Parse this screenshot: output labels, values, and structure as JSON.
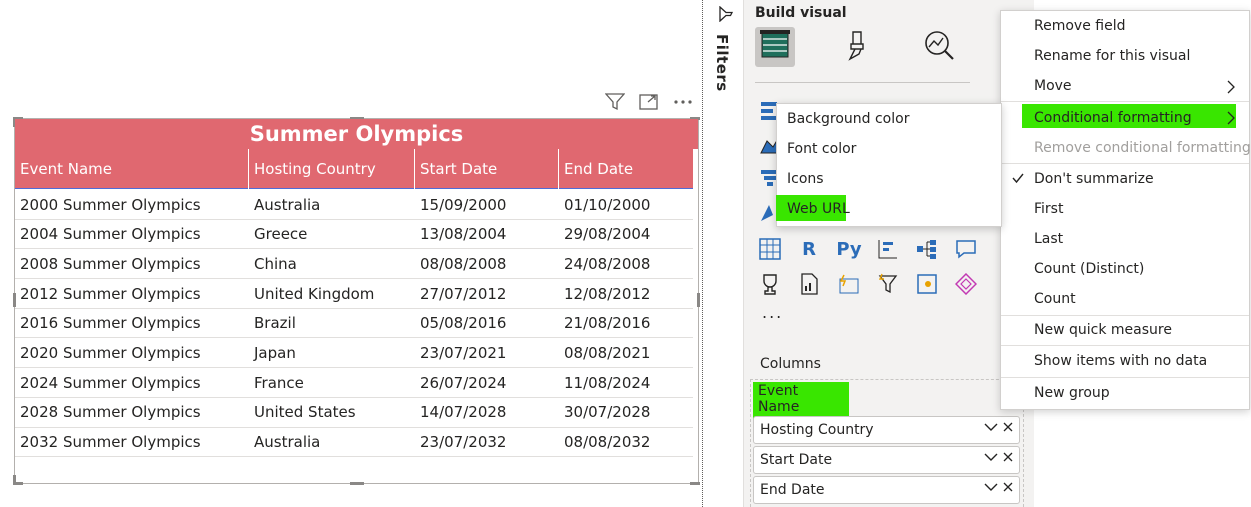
{
  "table": {
    "title": "Summer Olympics",
    "columns": [
      "Event Name",
      "Hosting Country",
      "Start Date",
      "End Date"
    ],
    "rows": [
      [
        "2000 Summer Olympics",
        "Australia",
        "15/09/2000",
        "01/10/2000"
      ],
      [
        "2004 Summer Olympics",
        "Greece",
        "13/08/2004",
        "29/08/2004"
      ],
      [
        "2008 Summer Olympics",
        "China",
        "08/08/2008",
        "24/08/2008"
      ],
      [
        "2012 Summer Olympics",
        "United Kingdom",
        "27/07/2012",
        "12/08/2012"
      ],
      [
        "2016 Summer Olympics",
        "Brazil",
        "05/08/2016",
        "21/08/2016"
      ],
      [
        "2020 Summer Olympics",
        "Japan",
        "23/07/2021",
        "08/08/2021"
      ],
      [
        "2024 Summer Olympics",
        "France",
        "26/07/2024",
        "11/08/2024"
      ],
      [
        "2028 Summer Olympics",
        "United States",
        "14/07/2028",
        "30/07/2028"
      ],
      [
        "2032 Summer Olympics",
        "Australia",
        "23/07/2032",
        "08/08/2032"
      ]
    ]
  },
  "filters_label": "Filters",
  "pane": {
    "title": "Build visual",
    "columns_label": "Columns",
    "wells": [
      "Event Name",
      "Hosting Country",
      "Start Date",
      "End Date"
    ],
    "more_label": "..."
  },
  "context_menu": {
    "items": [
      "Remove field",
      "Rename for this visual",
      "Move",
      "Conditional formatting",
      "Remove conditional formatting",
      "Don't summarize",
      "First",
      "Last",
      "Count (Distinct)",
      "Count",
      "New quick measure",
      "Show items with no data",
      "New group"
    ],
    "checked": "Don't summarize"
  },
  "submenu": {
    "items": [
      "Background color",
      "Font color",
      "Icons",
      "Web URL"
    ]
  },
  "colors": {
    "header_bg": "#e06870",
    "highlight": "#39e600",
    "accent": "#2b6cb8"
  },
  "icons": [
    "filter-icon",
    "focus-mode-icon",
    "more-options-icon",
    "filter-funnel-icon",
    "build-table-icon",
    "format-brush-icon",
    "analytics-icon",
    "chevron-right-icon",
    "chevron-down-icon",
    "close-icon",
    "checkmark-icon"
  ]
}
